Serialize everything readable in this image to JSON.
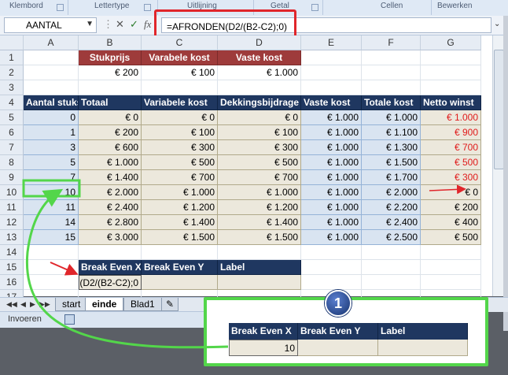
{
  "ribbon": {
    "groups": [
      "Klembord",
      "Lettertype",
      "Uitlijning",
      "Getal",
      "Cellen",
      "Bewerken"
    ]
  },
  "formula_bar": {
    "name_box": "AANTAL",
    "cancel_icon": "✕",
    "enter_icon": "✓",
    "fx_icon": "fx",
    "formula": "=AFRONDEN(D2/(B2-C2);0)"
  },
  "columns": [
    "A",
    "B",
    "C",
    "D",
    "E",
    "F",
    "G"
  ],
  "rows": [
    "1",
    "2",
    "3",
    "4",
    "5",
    "6",
    "7",
    "8",
    "9",
    "10",
    "11",
    "12",
    "13",
    "14",
    "15",
    "16",
    "17"
  ],
  "inputs": {
    "headers": [
      "Stukprijs",
      "Varabele kost",
      "Vaste kost"
    ],
    "values": [
      "€ 200",
      "€ 100",
      "€ 1.000"
    ]
  },
  "table": {
    "headers": [
      "Aantal stuks",
      "Totaal",
      "Variabele kost",
      "Dekkingsbijdrage",
      "Vaste kost",
      "Totale kost",
      "Netto winst"
    ],
    "rows": [
      [
        "0",
        "€ 0",
        "€ 0",
        "€ 0",
        "€ 1.000",
        "€ 1.000",
        "€ 1.000"
      ],
      [
        "1",
        "€ 200",
        "€ 100",
        "€ 100",
        "€ 1.000",
        "€ 1.100",
        "€ 900"
      ],
      [
        "3",
        "€ 600",
        "€ 300",
        "€ 300",
        "€ 1.000",
        "€ 1.300",
        "€ 700"
      ],
      [
        "5",
        "€ 1.000",
        "€ 500",
        "€ 500",
        "€ 1.000",
        "€ 1.500",
        "€ 500"
      ],
      [
        "7",
        "€ 1.400",
        "€ 700",
        "€ 700",
        "€ 1.000",
        "€ 1.700",
        "€ 300"
      ],
      [
        "10",
        "€ 2.000",
        "€ 1.000",
        "€ 1.000",
        "€ 1.000",
        "€ 2.000",
        "€ 0"
      ],
      [
        "11",
        "€ 2.400",
        "€ 1.200",
        "€ 1.200",
        "€ 1.000",
        "€ 2.200",
        "€ 200"
      ],
      [
        "14",
        "€ 2.800",
        "€ 1.400",
        "€ 1.400",
        "€ 1.000",
        "€ 2.400",
        "€ 400"
      ],
      [
        "15",
        "€ 3.000",
        "€ 1.500",
        "€ 1.500",
        "€ 1.000",
        "€ 2.500",
        "€ 500"
      ]
    ]
  },
  "break_even": {
    "headers": [
      "Break Even X",
      "Break Even Y",
      "Label"
    ],
    "editing_value": "D2/(B2-C2);0)"
  },
  "sheet_tabs": [
    "start",
    "einde",
    "Blad1"
  ],
  "active_tab": "einde",
  "status": {
    "mode": "Invoeren"
  },
  "callout": {
    "badge": "1",
    "headers": [
      "Break Even X",
      "Break Even Y",
      "Label"
    ],
    "result": "10"
  },
  "colors": {
    "header_dark": "#1f3760",
    "header_red": "#9e3b3b",
    "cell_blue": "#d9e4f1",
    "cell_tan": "#ece8dc",
    "negative_red": "#e01b1b",
    "highlight_red": "#e0262b",
    "callout_green": "#53d64a"
  }
}
